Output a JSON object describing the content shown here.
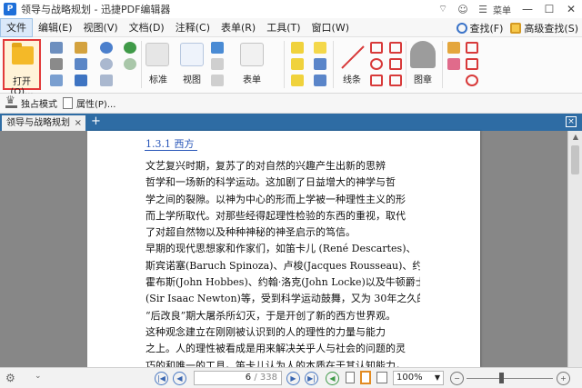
{
  "window": {
    "app_logo": "P",
    "title": "领导与战略规划 - 迅捷PDF编辑器",
    "menu_label": "菜单",
    "minimize": "—",
    "maximize": "☐",
    "close": "✕"
  },
  "menu": {
    "items": [
      "文件",
      "编辑(E)",
      "视图(V)",
      "文档(D)",
      "注释(C)",
      "表单(R)",
      "工具(T)",
      "窗口(W)"
    ],
    "find": "查找(F)",
    "advanced_find": "高级查找(S)"
  },
  "ribbon": {
    "open_label": "打开(O)...",
    "stamp_label": "标准",
    "view_label": "视图",
    "form_label": "表单",
    "line_label": "线条",
    "stamp2_label": "图章"
  },
  "toolbar2": {
    "exclusive_mode": "独占模式",
    "properties": "属性(P)..."
  },
  "tabs": {
    "active": "领导与战略规划",
    "close": "×",
    "add": "+",
    "close_all": "×"
  },
  "document": {
    "heading": "1.3.1  西方",
    "lines": [
      "    文艺复兴时期，复苏了的对自然的兴趣产生出新的思辨",
      "哲学和一场新的科学运动。这加剧了日益增大的神学与哲",
      "学之间的裂隙。以神为中心的形而上学被一种理性主义的形",
      "而上学所取代。对那些经得起理性检验的东西的重视，取代",
      "了对超自然物以及种种神秘的神圣启示的笃信。",
      "    早期的现代思想家和作家们，如笛卡儿 (René Descartes)、",
      "斯宾诺塞(Baruch Spinoza)、卢梭(Jacques Rousseau)、约翰·",
      "霍布斯(John Hobbes)、约翰·洛克(John Locke)以及牛顿爵士",
      "(Sir Isaac Newton)等，受到科学运动鼓舞，又为 30年之久的",
      "“后改良”期大屠杀所幻灭，于是开创了新的西方世界观。",
      "    这种观念建立在刚刚被认识到的人的理性的力量与能力",
      "之上。人的理性被看成是用来解决关乎人与社会的问题的灵",
      "巧的和唯一的工具。笛卡儿认为人的本质在于其认知能力，"
    ]
  },
  "status": {
    "current_page": "6",
    "total_pages": "/ 338",
    "zoom": "100%",
    "zoom_fraction": 0.4
  }
}
